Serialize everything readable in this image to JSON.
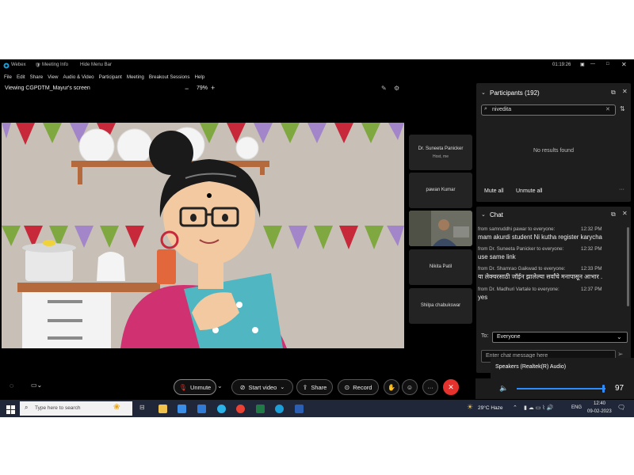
{
  "window": {
    "app_name": "Webex",
    "meeting_info": "Meeting Info",
    "hide_menu_bar": "Hide Menu Bar",
    "timer": "01:19:26"
  },
  "menu": [
    "File",
    "Edit",
    "Share",
    "View",
    "Audio & Video",
    "Participant",
    "Meeting",
    "Breakout Sessions",
    "Help"
  ],
  "share": {
    "viewing_label": "Viewing CGPDTM_Mayur's screen",
    "zoom": "79%",
    "zoom_minus": "−",
    "zoom_plus": "+"
  },
  "video_tiles": [
    {
      "name": "Dr. Suneeta Panicker",
      "subtitle": "Host, me"
    },
    {
      "name": "pawan Kumar",
      "subtitle": ""
    },
    {
      "name": "",
      "subtitle": ""
    },
    {
      "name": "Nikita Patil",
      "subtitle": ""
    },
    {
      "name": "Shilpa chabukswar",
      "subtitle": ""
    }
  ],
  "participants": {
    "title": "Participants (192)",
    "search_value": "nivedita",
    "no_results": "No results found",
    "mute_all": "Mute all",
    "unmute_all": "Unmute all"
  },
  "chat": {
    "title": "Chat",
    "messages": [
      {
        "meta": "from samruddhi pawar to everyone:",
        "time": "12:32 PM",
        "text": "mam akurdi student Ni kutha register karycha"
      },
      {
        "meta": "from Dr. Suneeta Panicker to everyone:",
        "time": "12:32 PM",
        "text": "use same link"
      },
      {
        "meta": "from Dr. Shamrao Gaikwad to everyone:",
        "time": "12:33 PM",
        "text": "या लेक्चरसाठी जॉईन झालेल्या सर्वांचे मनापासून आभार ."
      },
      {
        "meta": "from Dr. Madhuri Vartale to everyone:",
        "time": "12:37 PM",
        "text": "yes"
      }
    ],
    "to_label": "To:",
    "to_value": "Everyone",
    "input_placeholder": "Enter chat message here"
  },
  "audio_popup": {
    "device": "Speakers (Realtek(R) Audio)",
    "volume": 97
  },
  "controls": {
    "unmute": "Unmute",
    "start_video": "Start video",
    "share": "Share",
    "record": "Record",
    "more": "···"
  },
  "taskbar": {
    "search_placeholder": "Type here to search",
    "weather": "29°C  Haze",
    "language": "ENG",
    "time": "12:40",
    "date": "09-02-2023"
  },
  "colors": {
    "accent_blue": "#2b8cff",
    "leave_red": "#e5322d",
    "unmute_icon_red": "#e5322d"
  }
}
